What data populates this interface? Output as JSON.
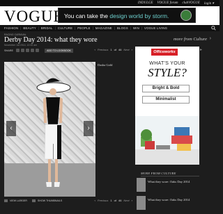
{
  "topbar": {
    "links": [
      "INDULGE",
      "VOGUE forum",
      "clubVOGUE",
      "login ▾"
    ]
  },
  "header": {
    "logo": "VOGUE"
  },
  "banner": {
    "prefix": "You can take the ",
    "highlight": "design world by storm.",
    "icon": "badge-icon"
  },
  "nav": {
    "items": [
      "FASHION",
      "BEAUTY",
      "BRIDAL",
      "CULTURE",
      "PEOPLE",
      "MAGAZINE",
      "BLOGS",
      "WIN",
      "VOGUE LIVING"
    ]
  },
  "article": {
    "breadcrumb": "RACING CARNIVAL",
    "title": "Derby Day 2014: what they wore",
    "date": "November 1st 2014, 12:00 am",
    "more_from": "more from Culture",
    "share_label": "SHARE",
    "lookbook_label": "ADD TO LOOKBOOK",
    "caption": "Dasha Gold",
    "pager": {
      "prev": "Previous",
      "current": "1",
      "separator": "of",
      "total": "46",
      "next": "Next"
    },
    "view_larger": "VIEW LARGER",
    "show_thumbnails": "SHOW THUMBNAILS"
  },
  "ad": {
    "brand": "Officeworks",
    "line1": "WHAT'S YOUR",
    "line2": "STYLE?",
    "button1": "Bright & Bold",
    "button2": "Minimalist"
  },
  "more_from_culture": {
    "heading": "MORE FROM CULTURE",
    "items": [
      {
        "label": "What they wore: Oaks Day 2014"
      },
      {
        "label": "What they wore: Oaks Day 2014"
      }
    ]
  },
  "colors": {
    "accent": "#6fd1cf",
    "ad_red": "#d71f26",
    "background": "#1d1d1d"
  }
}
